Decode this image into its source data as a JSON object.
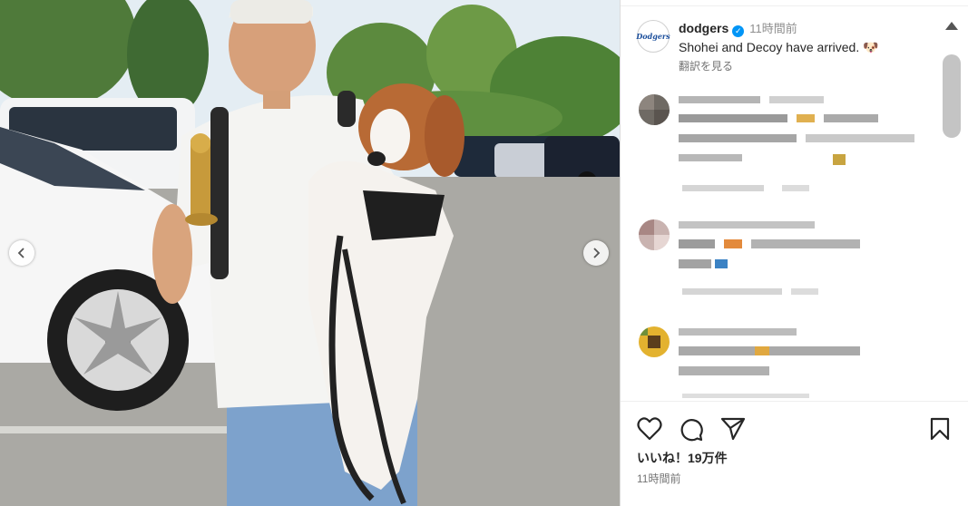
{
  "post": {
    "username": "dodgers",
    "verified_mark": "✓",
    "posted_relative": "11時間前",
    "caption": "Shohei and Decoy have arrived.",
    "caption_emoji": "🐶",
    "translate_label": "翻訳を見る",
    "likes_label": "いいね！19万件",
    "timestamp": "11時間前",
    "logo_text": "Dodgers"
  },
  "icons": {
    "like": "heart-icon",
    "comment": "comment-bubble-icon",
    "share": "paper-plane-icon",
    "save": "bookmark-icon",
    "prev": "chevron-left-icon",
    "next": "chevron-right-icon",
    "verified": "verified-badge-icon"
  },
  "colors": {
    "verified_blue": "#0095f6",
    "dodgers_blue": "#1c4f9c",
    "secondary_text": "#737373"
  }
}
